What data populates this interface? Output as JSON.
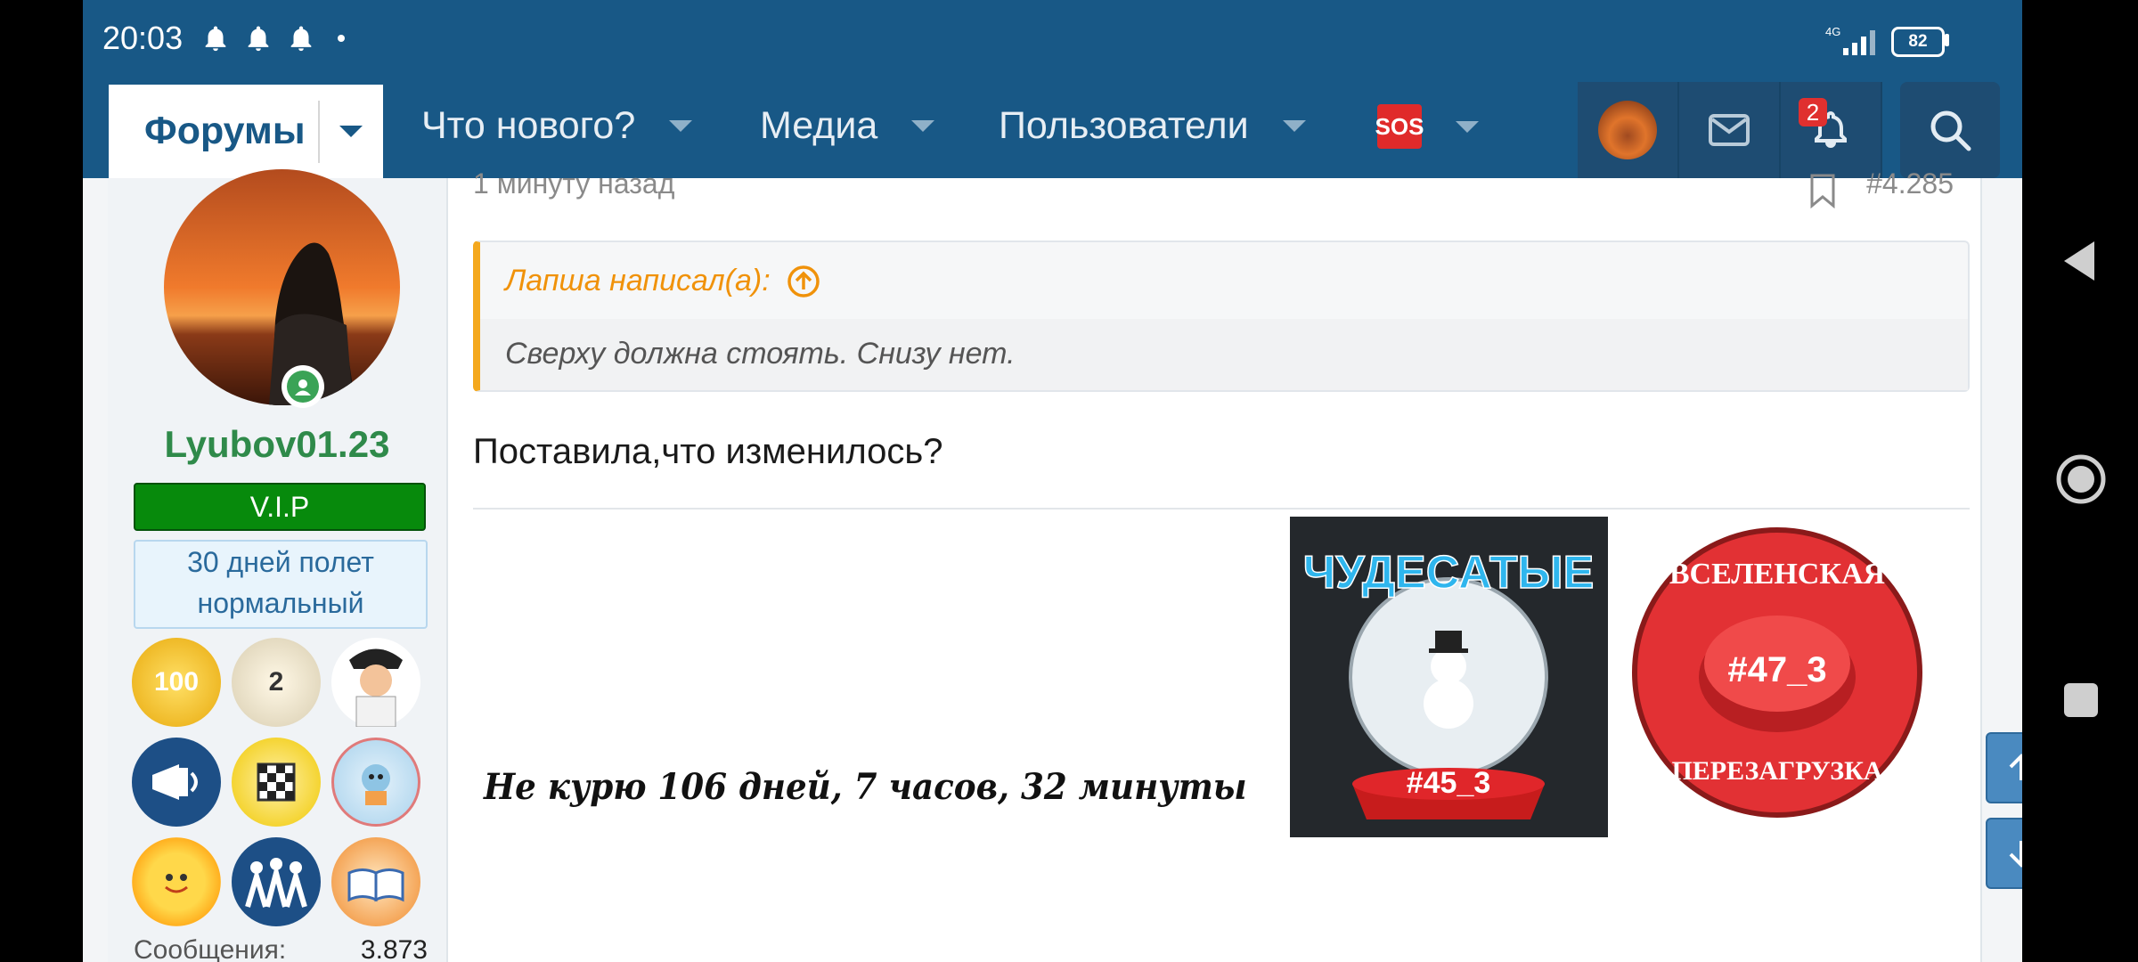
{
  "status_bar": {
    "time": "20:03",
    "network": "4G",
    "battery": "82"
  },
  "nav": {
    "items": [
      {
        "label": "Форумы"
      },
      {
        "label": "Что нового?"
      },
      {
        "label": "Медиа"
      },
      {
        "label": "Пользователи"
      },
      {
        "label": "SOS"
      }
    ],
    "notification_count": "2"
  },
  "profile": {
    "username": "Lyubov01.23",
    "title_badge": "V.I.P",
    "status_line1": "30 дней полет",
    "status_line2": "нормальный",
    "messages_label": "Сообщения:",
    "messages_value": "3.873",
    "trophies": [
      {
        "icon": "gold-100-trophy-icon",
        "text": "100"
      },
      {
        "icon": "airplane-2-trophy-icon",
        "text": "2"
      },
      {
        "icon": "pilot-trophy-icon",
        "text": ""
      },
      {
        "icon": "megaphone-trophy-icon",
        "text": ""
      },
      {
        "icon": "checkered-medal-trophy-icon",
        "text": ""
      },
      {
        "icon": "cartoon-trophy-icon",
        "text": ""
      },
      {
        "icon": "sun-trophy-icon",
        "text": ""
      },
      {
        "icon": "people-trophy-icon",
        "text": ""
      },
      {
        "icon": "book-trophy-icon",
        "text": ""
      }
    ]
  },
  "post": {
    "time_ago": "1 минуту назад",
    "number": "#4.285",
    "quote_author": "Лапша написал(а):",
    "quote_text": "Сверху должна стоять. Снизу нет.",
    "text": "Поставила,что изменилось?",
    "signature_text": "Не курю 106 дней, 7 часов, 32 минуты",
    "image1_title": "ЧУДЕСАТЫЕ",
    "image1_label": "#45_3",
    "image2_top": "ВСЕЛЕНСКАЯ",
    "image2_bottom": "ПЕРЕЗАГРУЗКА",
    "image2_label": "#47_3"
  },
  "colors": {
    "brand": "#185886",
    "vip": "#078a0c",
    "username": "#2f8a4a",
    "quote_accent": "#f4a81d"
  }
}
